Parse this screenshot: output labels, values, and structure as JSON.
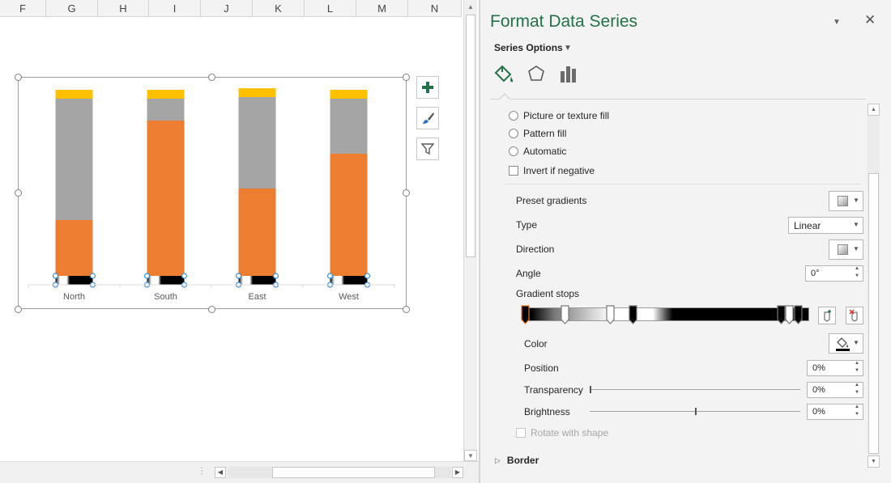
{
  "columns": [
    "F",
    "G",
    "H",
    "I",
    "J",
    "K",
    "L",
    "M",
    "N"
  ],
  "chart_data": {
    "type": "bar",
    "stacked": true,
    "categories": [
      "North",
      "South",
      "East",
      "West"
    ],
    "series": [
      {
        "values": [
          69,
          192,
          108,
          151
        ],
        "color": "#ED7D31"
      },
      {
        "values": [
          150,
          27,
          113,
          68
        ],
        "color": "#A5A5A5"
      },
      {
        "values": [
          11,
          11,
          11,
          11
        ],
        "color": "#FFC000"
      }
    ],
    "ylim": [
      0,
      230
    ],
    "legend": "none",
    "grid": false
  },
  "chart_buttons": {
    "elements": "chart-elements-plus-icon",
    "styles": "chart-styles-brush-icon",
    "filters": "chart-filters-funnel-icon"
  },
  "pane": {
    "title": "Format Data Series",
    "series_options_label": "Series Options",
    "tabs": [
      "fill-line-icon",
      "effects-pentagon-icon",
      "series-options-bars-icon"
    ],
    "fill_options": [
      {
        "label": "Picture or texture fill",
        "checked": false
      },
      {
        "label": "Pattern fill",
        "checked": false
      },
      {
        "label": "Automatic",
        "checked": false
      }
    ],
    "invert_label": "Invert if negative",
    "preset_gradients_label": "Preset gradients",
    "type_label": "Type",
    "type_value": "Linear",
    "direction_label": "Direction",
    "angle_label": "Angle",
    "angle_value": "0°",
    "gradient_stops_label": "Gradient stops",
    "gradient_stops": [
      {
        "color": "#000000",
        "position": 0,
        "selected": true
      },
      {
        "color": "#ffffff",
        "position": 14
      },
      {
        "color": "#ffffff",
        "position": 30
      },
      {
        "color": "#000000",
        "position": 38
      },
      {
        "color": "#000000",
        "position": 90
      },
      {
        "color": "#ffffff",
        "position": 93
      },
      {
        "color": "#000000",
        "position": 96
      }
    ],
    "color_label": "Color",
    "position_label": "Position",
    "position_value": "0%",
    "transparency_label": "Transparency",
    "transparency_value": "0%",
    "transparency_level": 0,
    "brightness_label": "Brightness",
    "brightness_value": "0%",
    "brightness_level": 0.5,
    "rotate_label": "Rotate with shape",
    "border_label": "Border"
  }
}
